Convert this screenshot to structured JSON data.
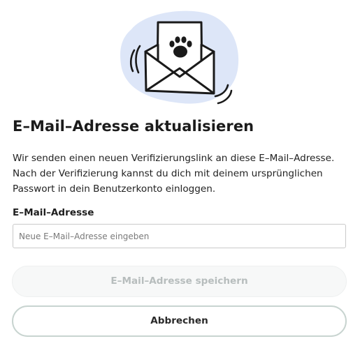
{
  "illustration": {
    "icon": "envelope-with-paw-letter-icon",
    "blob_color": "#dde6f8"
  },
  "heading": "E–Mail–Adresse aktualisieren",
  "description": {
    "line1": "Wir senden einen neuen Verifizierungslink an diese E–Mail–Adresse.",
    "line2": "Nach der Verifizierung kannst du dich mit deinem ursprünglichen",
    "line3": "Passwort in dein Benutzerkonto einloggen."
  },
  "form": {
    "email_label": "E–Mail–Adresse",
    "email_value": "",
    "email_placeholder": "Neue E–Mail–Adresse eingeben"
  },
  "buttons": {
    "save_label": "E–Mail–Adresse speichern",
    "save_state": "disabled",
    "cancel_label": "Abbrechen"
  }
}
